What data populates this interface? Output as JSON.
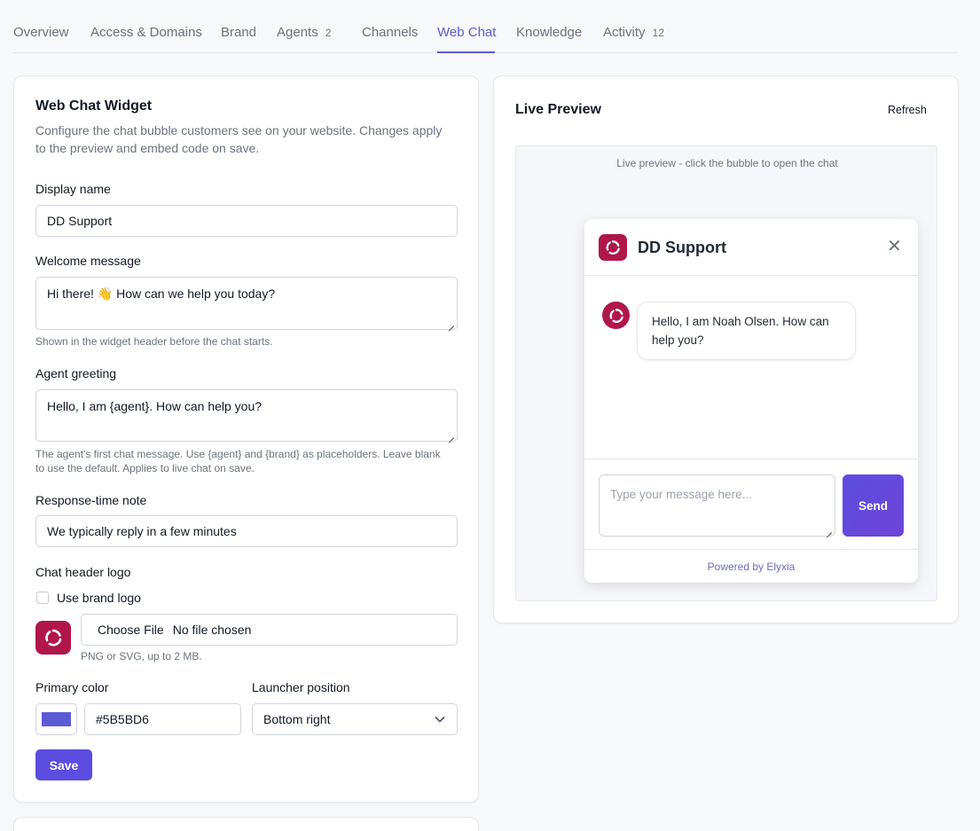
{
  "tabs": [
    {
      "label": "Overview"
    },
    {
      "label": "Access & Domains"
    },
    {
      "label": "Brand"
    },
    {
      "label": "Agents",
      "count": "2"
    },
    {
      "label": "Channels"
    },
    {
      "label": "Web Chat",
      "active": true
    },
    {
      "label": "Knowledge"
    },
    {
      "label": "Activity",
      "count": "12"
    }
  ],
  "widget": {
    "title": "Web Chat Widget",
    "description": "Configure the chat bubble customers see on your website. Changes apply to the preview and embed code on save.",
    "display_name_label": "Display name",
    "display_name_value": "DD Support",
    "welcome_label": "Welcome message",
    "welcome_value": "Hi there! 👋 How can we help you today?",
    "welcome_help": "Shown in the widget header before the chat starts.",
    "greeting_label": "Agent greeting",
    "greeting_value": "Hello, I am {agent}. How can help you?",
    "greeting_help": "The agent's first chat message. Use {agent} and {brand} as placeholders. Leave blank to use the default. Applies to live chat on save.",
    "response_label": "Response-time note",
    "response_value": "We typically reply in a few minutes",
    "logo_label": "Chat header logo",
    "use_brand_logo_label": "Use brand logo",
    "use_brand_logo_checked": false,
    "choose_file_label": "Choose File",
    "no_file_label": "No file chosen",
    "file_help": "PNG or SVG, up to 2 MB.",
    "primary_color_label": "Primary color",
    "primary_color_value": "#5B5BD6",
    "launcher_label": "Launcher position",
    "launcher_value": "Bottom right",
    "save_label": "Save"
  },
  "preview": {
    "title": "Live Preview",
    "refresh_label": "Refresh",
    "hint": "Live preview - click the bubble to open the chat",
    "chat_title": "DD Support",
    "close_glyph": "✕",
    "agent_message": "Hello, I am Noah Olsen. How can help you?",
    "input_placeholder": "Type your message here...",
    "send_label": "Send",
    "powered_by": "Powered by Elyxia"
  },
  "colors": {
    "accent": "#5b5bd6",
    "brand_logo": "#b0164a",
    "save_button": "#5b4de0"
  },
  "icons": {
    "logo": "brand-refresh-logo-icon",
    "close": "close-icon",
    "dropdown": "chevron-down-icon"
  }
}
